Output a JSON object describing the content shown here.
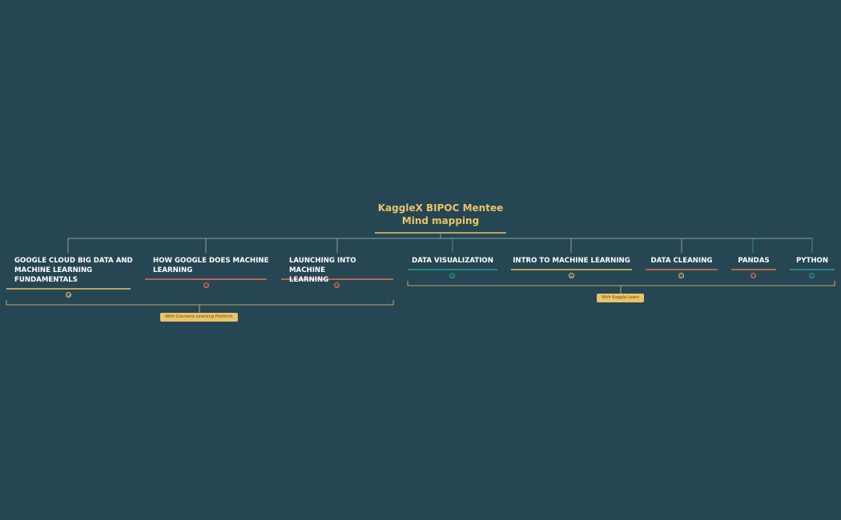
{
  "root": {
    "line1": "KaggleX BIPOC Mentee",
    "line2": "Mind mapping"
  },
  "groups": [
    {
      "label": "With Coursera Learning Platform"
    },
    {
      "label": "With Kaggle Learn"
    }
  ],
  "topics": [
    {
      "lines": [
        "GOOGLE CLOUD BIG DATA AND",
        "MACHINE LEARNING",
        "FUNDAMENTALS"
      ],
      "badge": "19"
    },
    {
      "lines": [
        "HOW GOOGLE DOES MACHINE",
        "LEARNING"
      ],
      "badge": "17"
    },
    {
      "lines": [
        "LAUNCHING INTO MACHINE",
        "LEARNING"
      ],
      "badge": "12"
    },
    {
      "lines": [
        "DATA VISUALIZATION"
      ],
      "badge": "15"
    },
    {
      "lines": [
        "INTRO TO MACHINE LEARNING"
      ],
      "badge": "6"
    },
    {
      "lines": [
        "DATA CLEANING"
      ],
      "badge": "7"
    },
    {
      "lines": [
        "PANDAS"
      ],
      "badge": "13"
    },
    {
      "lines": [
        "PYTHON"
      ],
      "badge": "4"
    }
  ],
  "colors": {
    "background": "#264653",
    "root": "#e9c46a",
    "orange": "#e76f51",
    "teal": "#2a9d8f",
    "callout": "#e9c46a"
  }
}
